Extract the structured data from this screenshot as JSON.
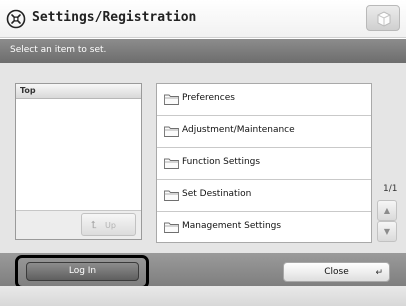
{
  "header": {
    "title": "Settings/Registration",
    "icon": "settings-registration-icon",
    "top_button_icon": "shelf-icon"
  },
  "instruction": "Select an item to set.",
  "tree": {
    "header": "Top",
    "up_button": {
      "label": "Up",
      "icon": "up-arrow-icon",
      "enabled": false
    }
  },
  "list": {
    "items": [
      {
        "label": "Preferences",
        "icon": "folder-icon"
      },
      {
        "label": "Adjustment/Maintenance",
        "icon": "folder-icon"
      },
      {
        "label": "Function Settings",
        "icon": "folder-icon"
      },
      {
        "label": "Set Destination",
        "icon": "folder-icon"
      },
      {
        "label": "Management Settings",
        "icon": "folder-icon"
      }
    ],
    "page": "1/1"
  },
  "footer": {
    "login_label": "Log In",
    "close_label": "Close"
  },
  "colors": {
    "instruction_bar": "#7a7a7a",
    "content_bg": "#e5e5e5",
    "highlight": "#000000"
  }
}
